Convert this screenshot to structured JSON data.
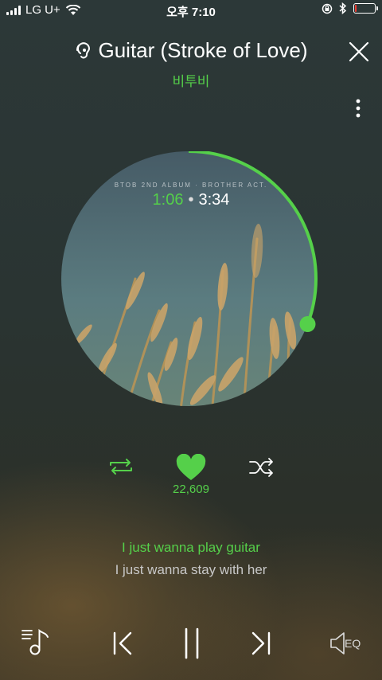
{
  "status_bar": {
    "carrier": "LG U+",
    "time": "오후 7:10",
    "signal_bars": 4,
    "battery_level": 0.08,
    "battery_color": "#ff3b30"
  },
  "track": {
    "title": "Guitar (Stroke of Love)",
    "artist": "비투비",
    "album_text": "BTOB 2ND ALBUM · BROTHER ACT.",
    "current_time": "1:06",
    "total_time": "3:34",
    "progress": 0.308
  },
  "actions": {
    "like_count": "22,609"
  },
  "lyrics": {
    "current": "I just wanna play guitar",
    "next": "I just wanna stay with her"
  },
  "controls": {
    "eq_label": "EQ"
  },
  "icons": {
    "title_icon": "ear-hearing-icon",
    "close": "close-icon",
    "more": "more-vertical-icon",
    "repeat": "repeat-icon",
    "heart": "heart-icon",
    "shuffle": "shuffle-icon",
    "playlist": "playlist-music-icon",
    "prev": "skip-previous-icon",
    "pause": "pause-icon",
    "next": "skip-next-icon",
    "eq": "speaker-eq-icon"
  },
  "colors": {
    "accent": "#55d04a",
    "text_primary": "#ffffff",
    "text_secondary": "#c8c8c8"
  }
}
